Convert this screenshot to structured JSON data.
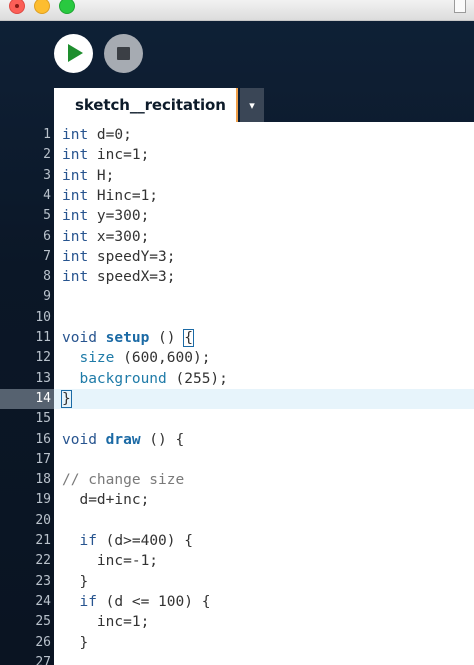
{
  "window": {
    "traffic_lights": [
      "close",
      "minimize",
      "maximize"
    ]
  },
  "toolbar": {
    "run_icon": "play-icon",
    "stop_icon": "stop-icon",
    "run_color": "#1e8e2e"
  },
  "tabs": [
    {
      "label": "sketch__recitation",
      "active": true
    }
  ],
  "tab_menu_symbol": "▾",
  "editor": {
    "active_line": 14,
    "lines": [
      {
        "num": "1",
        "tokens": [
          {
            "t": "int",
            "c": "kw"
          },
          {
            "t": " d=0;",
            "c": ""
          }
        ]
      },
      {
        "num": "2",
        "tokens": [
          {
            "t": "int",
            "c": "kw"
          },
          {
            "t": " inc=1;",
            "c": ""
          }
        ]
      },
      {
        "num": "3",
        "tokens": [
          {
            "t": "int",
            "c": "kw"
          },
          {
            "t": " H;",
            "c": ""
          }
        ]
      },
      {
        "num": "4",
        "tokens": [
          {
            "t": "int",
            "c": "kw"
          },
          {
            "t": " Hinc=1;",
            "c": ""
          }
        ]
      },
      {
        "num": "5",
        "tokens": [
          {
            "t": "int",
            "c": "kw"
          },
          {
            "t": " y=300;",
            "c": ""
          }
        ]
      },
      {
        "num": "6",
        "tokens": [
          {
            "t": "int",
            "c": "kw"
          },
          {
            "t": " x=300;",
            "c": ""
          }
        ]
      },
      {
        "num": "7",
        "tokens": [
          {
            "t": "int",
            "c": "kw"
          },
          {
            "t": " speedY=3;",
            "c": ""
          }
        ]
      },
      {
        "num": "8",
        "tokens": [
          {
            "t": "int",
            "c": "kw"
          },
          {
            "t": " speedX=3;",
            "c": ""
          }
        ]
      },
      {
        "num": "9",
        "tokens": []
      },
      {
        "num": "10",
        "tokens": []
      },
      {
        "num": "11",
        "tokens": [
          {
            "t": "void",
            "c": "kw"
          },
          {
            "t": " ",
            "c": ""
          },
          {
            "t": "setup",
            "c": "fn"
          },
          {
            "t": " () ",
            "c": ""
          },
          {
            "t": "{",
            "c": "box"
          }
        ]
      },
      {
        "num": "12",
        "tokens": [
          {
            "t": "  ",
            "c": ""
          },
          {
            "t": "size",
            "c": "api"
          },
          {
            "t": " (600,600);",
            "c": ""
          }
        ]
      },
      {
        "num": "13",
        "tokens": [
          {
            "t": "  ",
            "c": ""
          },
          {
            "t": "background",
            "c": "api"
          },
          {
            "t": " (255);",
            "c": ""
          }
        ]
      },
      {
        "num": "14",
        "tokens": [
          {
            "t": "}",
            "c": "box"
          }
        ]
      },
      {
        "num": "15",
        "tokens": []
      },
      {
        "num": "16",
        "tokens": [
          {
            "t": "void",
            "c": "kw"
          },
          {
            "t": " ",
            "c": ""
          },
          {
            "t": "draw",
            "c": "fn"
          },
          {
            "t": " () {",
            "c": ""
          }
        ]
      },
      {
        "num": "17",
        "tokens": []
      },
      {
        "num": "18",
        "tokens": [
          {
            "t": "// change size",
            "c": "cm"
          }
        ]
      },
      {
        "num": "19",
        "tokens": [
          {
            "t": "  d=d+inc;",
            "c": ""
          }
        ]
      },
      {
        "num": "20",
        "tokens": []
      },
      {
        "num": "21",
        "tokens": [
          {
            "t": "  ",
            "c": ""
          },
          {
            "t": "if",
            "c": "kw"
          },
          {
            "t": " (d>=400) {",
            "c": ""
          }
        ]
      },
      {
        "num": "22",
        "tokens": [
          {
            "t": "    inc=-1;",
            "c": ""
          }
        ]
      },
      {
        "num": "23",
        "tokens": [
          {
            "t": "  }",
            "c": ""
          }
        ]
      },
      {
        "num": "24",
        "tokens": [
          {
            "t": "  ",
            "c": ""
          },
          {
            "t": "if",
            "c": "kw"
          },
          {
            "t": " (d <= 100) {",
            "c": ""
          }
        ]
      },
      {
        "num": "25",
        "tokens": [
          {
            "t": "    inc=1;",
            "c": ""
          }
        ]
      },
      {
        "num": "26",
        "tokens": [
          {
            "t": "  }",
            "c": ""
          }
        ]
      },
      {
        "num": "27",
        "tokens": []
      }
    ]
  },
  "colors": {
    "keyword": "#27548f",
    "function": "#1b6aa5",
    "api": "#1f7ba8",
    "comment": "#7a7a7a",
    "tab_accent": "#f0a04a",
    "active_line_bg": "#e7f4fb"
  }
}
